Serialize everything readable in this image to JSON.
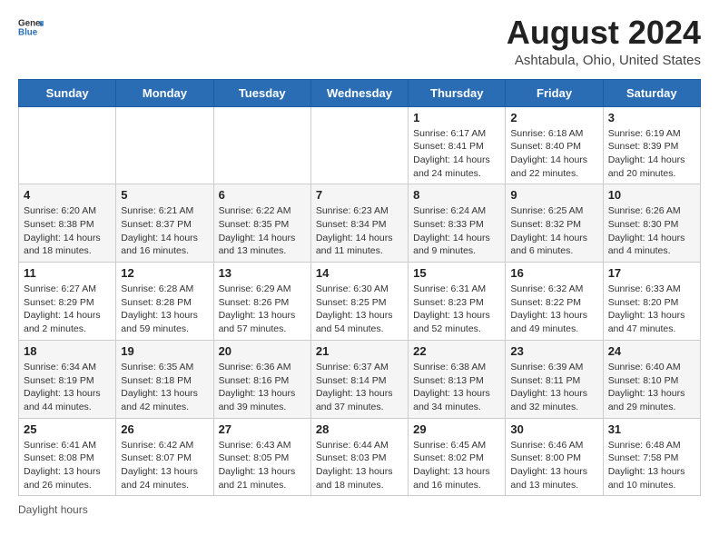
{
  "logo": {
    "general": "General",
    "blue": "Blue"
  },
  "title": "August 2024",
  "subtitle": "Ashtabula, Ohio, United States",
  "headers": [
    "Sunday",
    "Monday",
    "Tuesday",
    "Wednesday",
    "Thursday",
    "Friday",
    "Saturday"
  ],
  "footer": "Daylight hours",
  "weeks": [
    [
      {
        "day": "",
        "detail": ""
      },
      {
        "day": "",
        "detail": ""
      },
      {
        "day": "",
        "detail": ""
      },
      {
        "day": "",
        "detail": ""
      },
      {
        "day": "1",
        "detail": "Sunrise: 6:17 AM\nSunset: 8:41 PM\nDaylight: 14 hours and 24 minutes."
      },
      {
        "day": "2",
        "detail": "Sunrise: 6:18 AM\nSunset: 8:40 PM\nDaylight: 14 hours and 22 minutes."
      },
      {
        "day": "3",
        "detail": "Sunrise: 6:19 AM\nSunset: 8:39 PM\nDaylight: 14 hours and 20 minutes."
      }
    ],
    [
      {
        "day": "4",
        "detail": "Sunrise: 6:20 AM\nSunset: 8:38 PM\nDaylight: 14 hours and 18 minutes."
      },
      {
        "day": "5",
        "detail": "Sunrise: 6:21 AM\nSunset: 8:37 PM\nDaylight: 14 hours and 16 minutes."
      },
      {
        "day": "6",
        "detail": "Sunrise: 6:22 AM\nSunset: 8:35 PM\nDaylight: 14 hours and 13 minutes."
      },
      {
        "day": "7",
        "detail": "Sunrise: 6:23 AM\nSunset: 8:34 PM\nDaylight: 14 hours and 11 minutes."
      },
      {
        "day": "8",
        "detail": "Sunrise: 6:24 AM\nSunset: 8:33 PM\nDaylight: 14 hours and 9 minutes."
      },
      {
        "day": "9",
        "detail": "Sunrise: 6:25 AM\nSunset: 8:32 PM\nDaylight: 14 hours and 6 minutes."
      },
      {
        "day": "10",
        "detail": "Sunrise: 6:26 AM\nSunset: 8:30 PM\nDaylight: 14 hours and 4 minutes."
      }
    ],
    [
      {
        "day": "11",
        "detail": "Sunrise: 6:27 AM\nSunset: 8:29 PM\nDaylight: 14 hours and 2 minutes."
      },
      {
        "day": "12",
        "detail": "Sunrise: 6:28 AM\nSunset: 8:28 PM\nDaylight: 13 hours and 59 minutes."
      },
      {
        "day": "13",
        "detail": "Sunrise: 6:29 AM\nSunset: 8:26 PM\nDaylight: 13 hours and 57 minutes."
      },
      {
        "day": "14",
        "detail": "Sunrise: 6:30 AM\nSunset: 8:25 PM\nDaylight: 13 hours and 54 minutes."
      },
      {
        "day": "15",
        "detail": "Sunrise: 6:31 AM\nSunset: 8:23 PM\nDaylight: 13 hours and 52 minutes."
      },
      {
        "day": "16",
        "detail": "Sunrise: 6:32 AM\nSunset: 8:22 PM\nDaylight: 13 hours and 49 minutes."
      },
      {
        "day": "17",
        "detail": "Sunrise: 6:33 AM\nSunset: 8:20 PM\nDaylight: 13 hours and 47 minutes."
      }
    ],
    [
      {
        "day": "18",
        "detail": "Sunrise: 6:34 AM\nSunset: 8:19 PM\nDaylight: 13 hours and 44 minutes."
      },
      {
        "day": "19",
        "detail": "Sunrise: 6:35 AM\nSunset: 8:18 PM\nDaylight: 13 hours and 42 minutes."
      },
      {
        "day": "20",
        "detail": "Sunrise: 6:36 AM\nSunset: 8:16 PM\nDaylight: 13 hours and 39 minutes."
      },
      {
        "day": "21",
        "detail": "Sunrise: 6:37 AM\nSunset: 8:14 PM\nDaylight: 13 hours and 37 minutes."
      },
      {
        "day": "22",
        "detail": "Sunrise: 6:38 AM\nSunset: 8:13 PM\nDaylight: 13 hours and 34 minutes."
      },
      {
        "day": "23",
        "detail": "Sunrise: 6:39 AM\nSunset: 8:11 PM\nDaylight: 13 hours and 32 minutes."
      },
      {
        "day": "24",
        "detail": "Sunrise: 6:40 AM\nSunset: 8:10 PM\nDaylight: 13 hours and 29 minutes."
      }
    ],
    [
      {
        "day": "25",
        "detail": "Sunrise: 6:41 AM\nSunset: 8:08 PM\nDaylight: 13 hours and 26 minutes."
      },
      {
        "day": "26",
        "detail": "Sunrise: 6:42 AM\nSunset: 8:07 PM\nDaylight: 13 hours and 24 minutes."
      },
      {
        "day": "27",
        "detail": "Sunrise: 6:43 AM\nSunset: 8:05 PM\nDaylight: 13 hours and 21 minutes."
      },
      {
        "day": "28",
        "detail": "Sunrise: 6:44 AM\nSunset: 8:03 PM\nDaylight: 13 hours and 18 minutes."
      },
      {
        "day": "29",
        "detail": "Sunrise: 6:45 AM\nSunset: 8:02 PM\nDaylight: 13 hours and 16 minutes."
      },
      {
        "day": "30",
        "detail": "Sunrise: 6:46 AM\nSunset: 8:00 PM\nDaylight: 13 hours and 13 minutes."
      },
      {
        "day": "31",
        "detail": "Sunrise: 6:48 AM\nSunset: 7:58 PM\nDaylight: 13 hours and 10 minutes."
      }
    ]
  ]
}
